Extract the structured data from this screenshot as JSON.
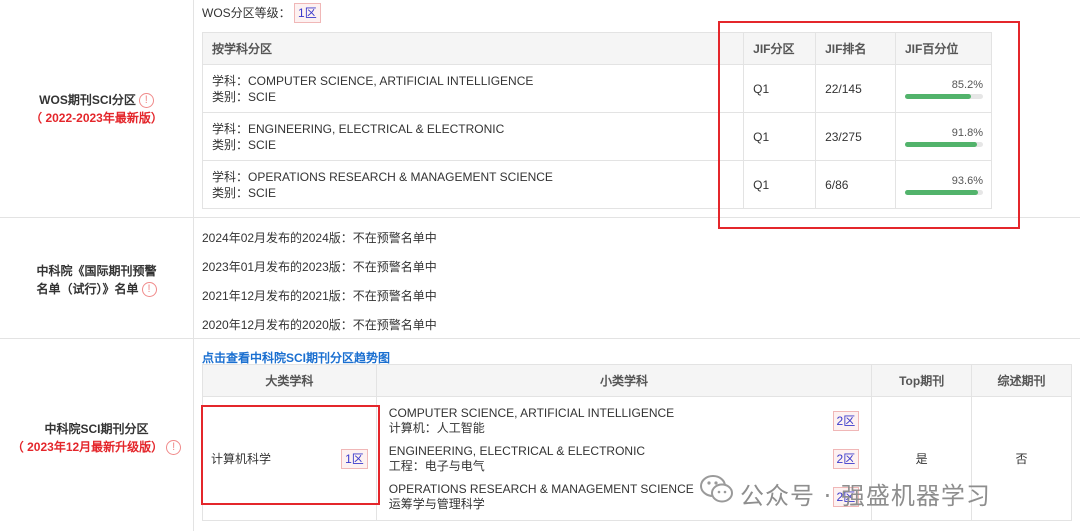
{
  "wos": {
    "level_label": "WOS分区等级：",
    "level_badge": "1区",
    "left_title": "WOS期刊SCI分区",
    "left_subtitle": "（ 2022-2023年最新版）",
    "headers": {
      "subject": "按学科分区",
      "jif_quartile": "JIF分区",
      "jif_rank": "JIF排名",
      "jif_percentile": "JIF百分位"
    },
    "rows": [
      {
        "subject": "学科：COMPUTER SCIENCE, ARTIFICIAL INTELLIGENCE",
        "category": "类别：SCIE",
        "quartile": "Q1",
        "rank": "22/145",
        "percentile": "85.2%",
        "percent_value": 85.2
      },
      {
        "subject": "学科：ENGINEERING, ELECTRICAL & ELECTRONIC",
        "category": "类别：SCIE",
        "quartile": "Q1",
        "rank": "23/275",
        "percentile": "91.8%",
        "percent_value": 91.8
      },
      {
        "subject": "学科：OPERATIONS RESEARCH & MANAGEMENT SCIENCE",
        "category": "类别：SCIE",
        "quartile": "Q1",
        "rank": "6/86",
        "percentile": "93.6%",
        "percent_value": 93.6
      }
    ]
  },
  "warning": {
    "left_title_1": "中科院《国际期刊预警",
    "left_title_2": "名单（试行）》名单",
    "lines": [
      "2024年02月发布的2024版：不在预警名单中",
      "2023年01月发布的2023版：不在预警名单中",
      "2021年12月发布的2021版：不在预警名单中",
      "2020年12月发布的2020版：不在预警名单中"
    ]
  },
  "cas": {
    "link": "点击查看中科院SCI期刊分区趋势图",
    "left_title": "中科院SCI期刊分区",
    "left_subtitle": "（ 2023年12月最新升级版）",
    "headers": {
      "major": "大类学科",
      "minor": "小类学科",
      "top": "Top期刊",
      "review": "综述期刊"
    },
    "major_subject": "计算机科学",
    "major_badge": "1区",
    "minor": [
      {
        "en": "COMPUTER SCIENCE, ARTIFICIAL INTELLIGENCE",
        "cn": "计算机：人工智能",
        "badge": "2区"
      },
      {
        "en": "ENGINEERING, ELECTRICAL & ELECTRONIC",
        "cn": "工程：电子与电气",
        "badge": "2区"
      },
      {
        "en": "OPERATIONS RESEARCH & MANAGEMENT SCIENCE",
        "cn": "运筹学与管理科学",
        "badge": "2区"
      }
    ],
    "top_value": "是",
    "review_value": "否"
  },
  "watermark": {
    "text": "公众号 · 强盛机器学习",
    "icon": "wechat-icon"
  },
  "colors": {
    "accent_red": "#e4262b",
    "bar_green": "#52b36b",
    "badge_text": "#3a3acb",
    "link_blue": "#1a6fd0"
  }
}
